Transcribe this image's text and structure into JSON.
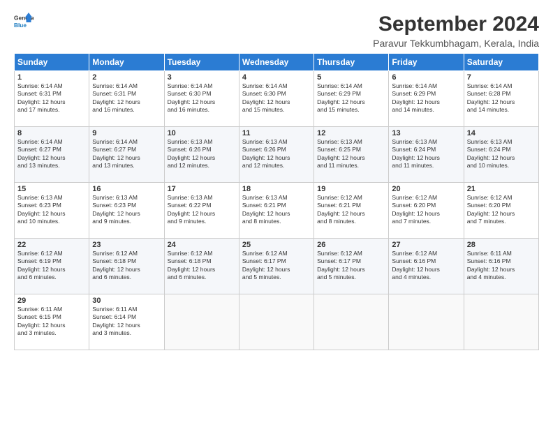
{
  "logo": {
    "line1": "General",
    "line2": "Blue"
  },
  "title": "September 2024",
  "subtitle": "Paravur Tekkumbhagam, Kerala, India",
  "headers": [
    "Sunday",
    "Monday",
    "Tuesday",
    "Wednesday",
    "Thursday",
    "Friday",
    "Saturday"
  ],
  "weeks": [
    [
      {
        "day": "1",
        "rise": "6:14 AM",
        "set": "6:31 PM",
        "daylight": "12 hours and 17 minutes."
      },
      {
        "day": "2",
        "rise": "6:14 AM",
        "set": "6:31 PM",
        "daylight": "12 hours and 16 minutes."
      },
      {
        "day": "3",
        "rise": "6:14 AM",
        "set": "6:30 PM",
        "daylight": "12 hours and 16 minutes."
      },
      {
        "day": "4",
        "rise": "6:14 AM",
        "set": "6:30 PM",
        "daylight": "12 hours and 15 minutes."
      },
      {
        "day": "5",
        "rise": "6:14 AM",
        "set": "6:29 PM",
        "daylight": "12 hours and 15 minutes."
      },
      {
        "day": "6",
        "rise": "6:14 AM",
        "set": "6:29 PM",
        "daylight": "12 hours and 14 minutes."
      },
      {
        "day": "7",
        "rise": "6:14 AM",
        "set": "6:28 PM",
        "daylight": "12 hours and 14 minutes."
      }
    ],
    [
      {
        "day": "8",
        "rise": "6:14 AM",
        "set": "6:27 PM",
        "daylight": "12 hours and 13 minutes."
      },
      {
        "day": "9",
        "rise": "6:14 AM",
        "set": "6:27 PM",
        "daylight": "12 hours and 13 minutes."
      },
      {
        "day": "10",
        "rise": "6:13 AM",
        "set": "6:26 PM",
        "daylight": "12 hours and 12 minutes."
      },
      {
        "day": "11",
        "rise": "6:13 AM",
        "set": "6:26 PM",
        "daylight": "12 hours and 12 minutes."
      },
      {
        "day": "12",
        "rise": "6:13 AM",
        "set": "6:25 PM",
        "daylight": "12 hours and 11 minutes."
      },
      {
        "day": "13",
        "rise": "6:13 AM",
        "set": "6:24 PM",
        "daylight": "12 hours and 11 minutes."
      },
      {
        "day": "14",
        "rise": "6:13 AM",
        "set": "6:24 PM",
        "daylight": "12 hours and 10 minutes."
      }
    ],
    [
      {
        "day": "15",
        "rise": "6:13 AM",
        "set": "6:23 PM",
        "daylight": "12 hours and 10 minutes."
      },
      {
        "day": "16",
        "rise": "6:13 AM",
        "set": "6:23 PM",
        "daylight": "12 hours and 9 minutes."
      },
      {
        "day": "17",
        "rise": "6:13 AM",
        "set": "6:22 PM",
        "daylight": "12 hours and 9 minutes."
      },
      {
        "day": "18",
        "rise": "6:13 AM",
        "set": "6:21 PM",
        "daylight": "12 hours and 8 minutes."
      },
      {
        "day": "19",
        "rise": "6:12 AM",
        "set": "6:21 PM",
        "daylight": "12 hours and 8 minutes."
      },
      {
        "day": "20",
        "rise": "6:12 AM",
        "set": "6:20 PM",
        "daylight": "12 hours and 7 minutes."
      },
      {
        "day": "21",
        "rise": "6:12 AM",
        "set": "6:20 PM",
        "daylight": "12 hours and 7 minutes."
      }
    ],
    [
      {
        "day": "22",
        "rise": "6:12 AM",
        "set": "6:19 PM",
        "daylight": "12 hours and 6 minutes."
      },
      {
        "day": "23",
        "rise": "6:12 AM",
        "set": "6:18 PM",
        "daylight": "12 hours and 6 minutes."
      },
      {
        "day": "24",
        "rise": "6:12 AM",
        "set": "6:18 PM",
        "daylight": "12 hours and 6 minutes."
      },
      {
        "day": "25",
        "rise": "6:12 AM",
        "set": "6:17 PM",
        "daylight": "12 hours and 5 minutes."
      },
      {
        "day": "26",
        "rise": "6:12 AM",
        "set": "6:17 PM",
        "daylight": "12 hours and 5 minutes."
      },
      {
        "day": "27",
        "rise": "6:12 AM",
        "set": "6:16 PM",
        "daylight": "12 hours and 4 minutes."
      },
      {
        "day": "28",
        "rise": "6:11 AM",
        "set": "6:16 PM",
        "daylight": "12 hours and 4 minutes."
      }
    ],
    [
      {
        "day": "29",
        "rise": "6:11 AM",
        "set": "6:15 PM",
        "daylight": "12 hours and 3 minutes."
      },
      {
        "day": "30",
        "rise": "6:11 AM",
        "set": "6:14 PM",
        "daylight": "12 hours and 3 minutes."
      },
      null,
      null,
      null,
      null,
      null
    ]
  ],
  "labels": {
    "sunrise": "Sunrise:",
    "sunset": "Sunset:",
    "daylight": "Daylight:"
  }
}
